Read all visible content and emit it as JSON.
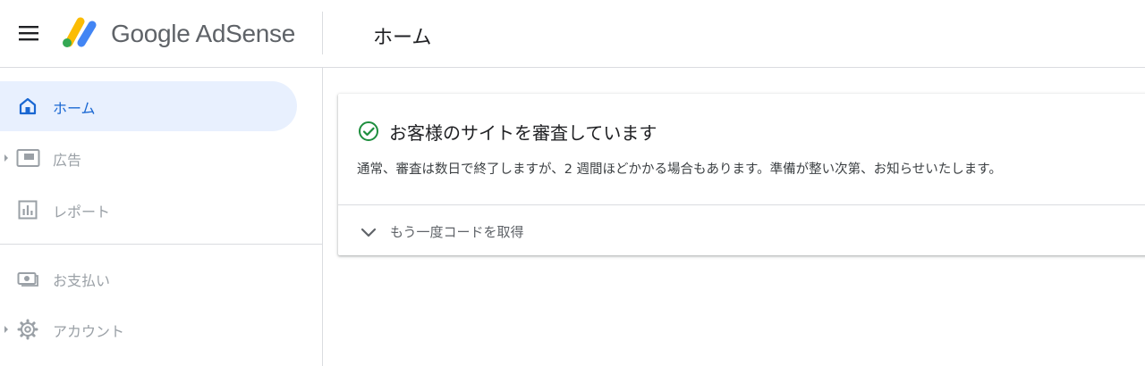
{
  "header": {
    "brand_google": "Google",
    "brand_product": "AdSense",
    "page_title": "ホーム",
    "menu_icon": "hamburger-menu-icon",
    "logo_icon": "adsense-logo-icon"
  },
  "sidebar": {
    "items": [
      {
        "label": "ホーム",
        "icon": "home-icon",
        "active": true,
        "expandable": false
      },
      {
        "label": "広告",
        "icon": "ads-icon",
        "active": false,
        "expandable": true
      },
      {
        "label": "レポート",
        "icon": "report-icon",
        "active": false,
        "expandable": false
      },
      {
        "label": "お支払い",
        "icon": "payments-icon",
        "active": false,
        "expandable": false
      },
      {
        "label": "アカウント",
        "icon": "gear-icon",
        "active": false,
        "expandable": true
      }
    ]
  },
  "main": {
    "status_card": {
      "title": "お客様のサイトを審査しています",
      "body": "通常、審査は数日で終了しますが、2 週間ほどかかる場合もあります。準備が整い次第、お知らせいたします。",
      "expand_label": "もう一度コードを取得",
      "status_icon": "check-circle-icon"
    }
  },
  "colors": {
    "accent": "#1967d2",
    "active_bg": "#e8f0fe",
    "success": "#1e8e3e",
    "muted": "#9aa0a6",
    "divider": "#dadce0"
  }
}
